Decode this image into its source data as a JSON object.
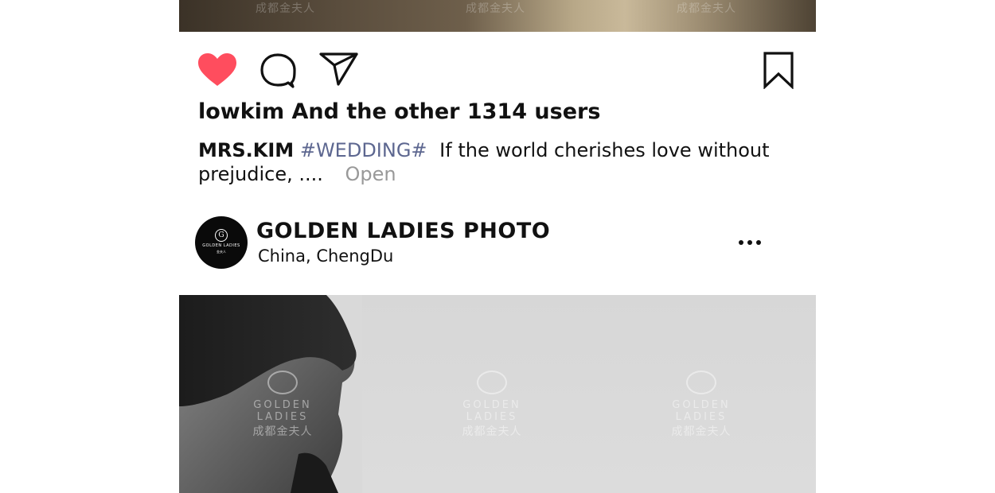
{
  "post": {
    "watermark_text": "成都金夫人",
    "likes_text": "lowkim And the other 1314 users",
    "caption": {
      "username": "MRS.KIM",
      "hashtag": "#WEDDING#",
      "text": "If the world cherishes love without prejudice, ....",
      "more_label": "Open"
    },
    "liked": true,
    "like_color": "#ff4d5e"
  },
  "next_post": {
    "account_name": "GOLDEN LADIES PHOTO",
    "location": "China, ChengDu",
    "avatar": {
      "monogram": "G",
      "brand": "GOLDEN LADIES",
      "brand_cn": "金夫人"
    },
    "watermark": {
      "brand": "GOLDEN LADIES",
      "brand_cn": "成都金夫人"
    }
  },
  "icons": {
    "like": "heart-icon",
    "comment": "comment-bubble-icon",
    "share": "send-icon",
    "save": "bookmark-icon",
    "more": "more-dots-icon"
  }
}
